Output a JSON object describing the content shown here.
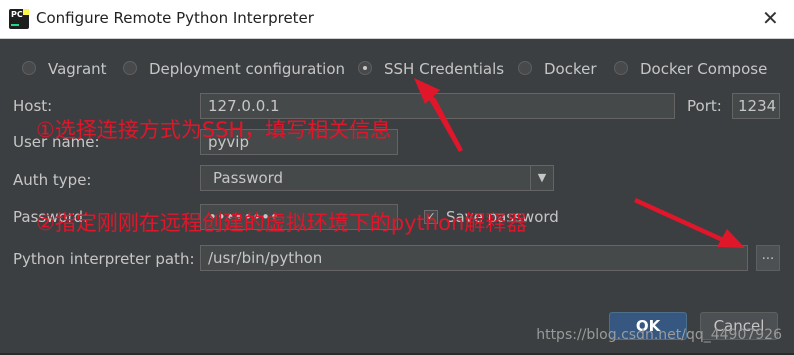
{
  "window": {
    "title": "Configure Remote Python Interpreter",
    "app_icon_label": "PC"
  },
  "modes": [
    {
      "label": "Vagrant",
      "selected": false
    },
    {
      "label": "Deployment configuration",
      "selected": false
    },
    {
      "label": "SSH Credentials",
      "selected": true
    },
    {
      "label": "Docker",
      "selected": false
    },
    {
      "label": "Docker Compose",
      "selected": false
    }
  ],
  "form": {
    "host_label": "Host:",
    "host_value": "127.0.0.1",
    "port_label": "Port:",
    "port_value": "1234",
    "username_label": "User name:",
    "username_value": "pyvip",
    "auth_label": "Auth type:",
    "auth_value": "Password",
    "password_label": "Password:",
    "password_value": "••••••••",
    "save_password_label": "Save password",
    "save_password_checked": true,
    "interpreter_label": "Python interpreter path:",
    "interpreter_value": "/usr/bin/python",
    "browse_label": "..."
  },
  "buttons": {
    "ok_label": "OK",
    "cancel_label": "Cancel"
  },
  "annotations": {
    "step1": "①选择连接方式为SSH，填写相关信息",
    "step2": "②指定刚刚在远程创建的虚拟环境下的python解释器",
    "color": "#e0162b"
  },
  "watermark": "https://blog.csdn.net/qq_44907926",
  "icons": {
    "close": "close-icon",
    "dropdown": "chevron-down-icon",
    "check": "checkmark-icon"
  }
}
